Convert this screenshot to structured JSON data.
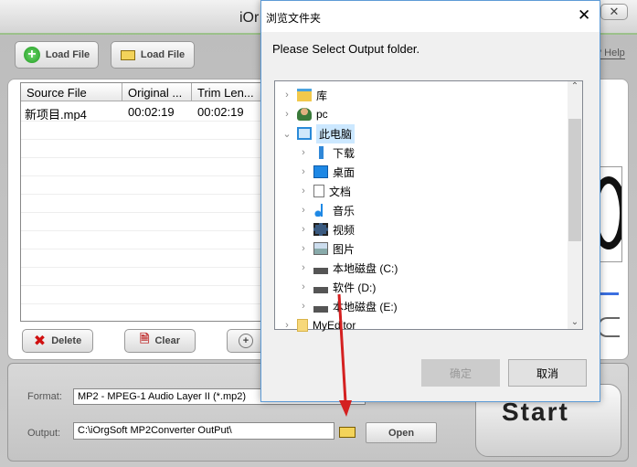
{
  "app": {
    "title": "iOr",
    "help_label": "? Help",
    "load_file_add": "Load File",
    "load_file_folder": "Load File",
    "table": {
      "columns": [
        "Source File",
        "Original ...",
        "Trim Len..."
      ],
      "rows": [
        [
          "新项目.mp4",
          "00:02:19",
          "00:02:19"
        ]
      ]
    },
    "delete_label": "Delete",
    "clear_label": "Clear",
    "format_label": "Format:",
    "format_value": "MP2 - MPEG-1 Audio Layer II (*.mp2)",
    "output_label": "Output:",
    "output_value": "C:\\iOrgSoft MP2Converter OutPut\\",
    "open_label": "Open",
    "start_label": "Start"
  },
  "dialog": {
    "title": "浏览文件夹",
    "prompt": "Please Select Output folder.",
    "tree": [
      {
        "label": "库",
        "level": 0,
        "icon": "library-icon",
        "expanded": false
      },
      {
        "label": "pc",
        "level": 0,
        "icon": "user-icon",
        "expanded": false
      },
      {
        "label": "此电脑",
        "level": 0,
        "icon": "computer-icon",
        "expanded": true,
        "selected": true
      },
      {
        "label": "下载",
        "level": 1,
        "icon": "download-icon"
      },
      {
        "label": "桌面",
        "level": 1,
        "icon": "desktop-icon"
      },
      {
        "label": "文档",
        "level": 1,
        "icon": "document-icon"
      },
      {
        "label": "音乐",
        "level": 1,
        "icon": "music-icon"
      },
      {
        "label": "视频",
        "level": 1,
        "icon": "video-icon"
      },
      {
        "label": "图片",
        "level": 1,
        "icon": "picture-icon"
      },
      {
        "label": "本地磁盘 (C:)",
        "level": 1,
        "icon": "drive-icon"
      },
      {
        "label": "软件 (D:)",
        "level": 1,
        "icon": "drive-icon"
      },
      {
        "label": "本地磁盘 (E:)",
        "level": 1,
        "icon": "drive-icon"
      },
      {
        "label": "MyEditor",
        "level": 0,
        "icon": "folder-icon"
      }
    ],
    "ok_label": "确定",
    "cancel_label": "取消"
  },
  "colors": {
    "selection": "#cce8ff",
    "annotation_arrow": "#d42020",
    "accent_line": "#9bc08a"
  }
}
